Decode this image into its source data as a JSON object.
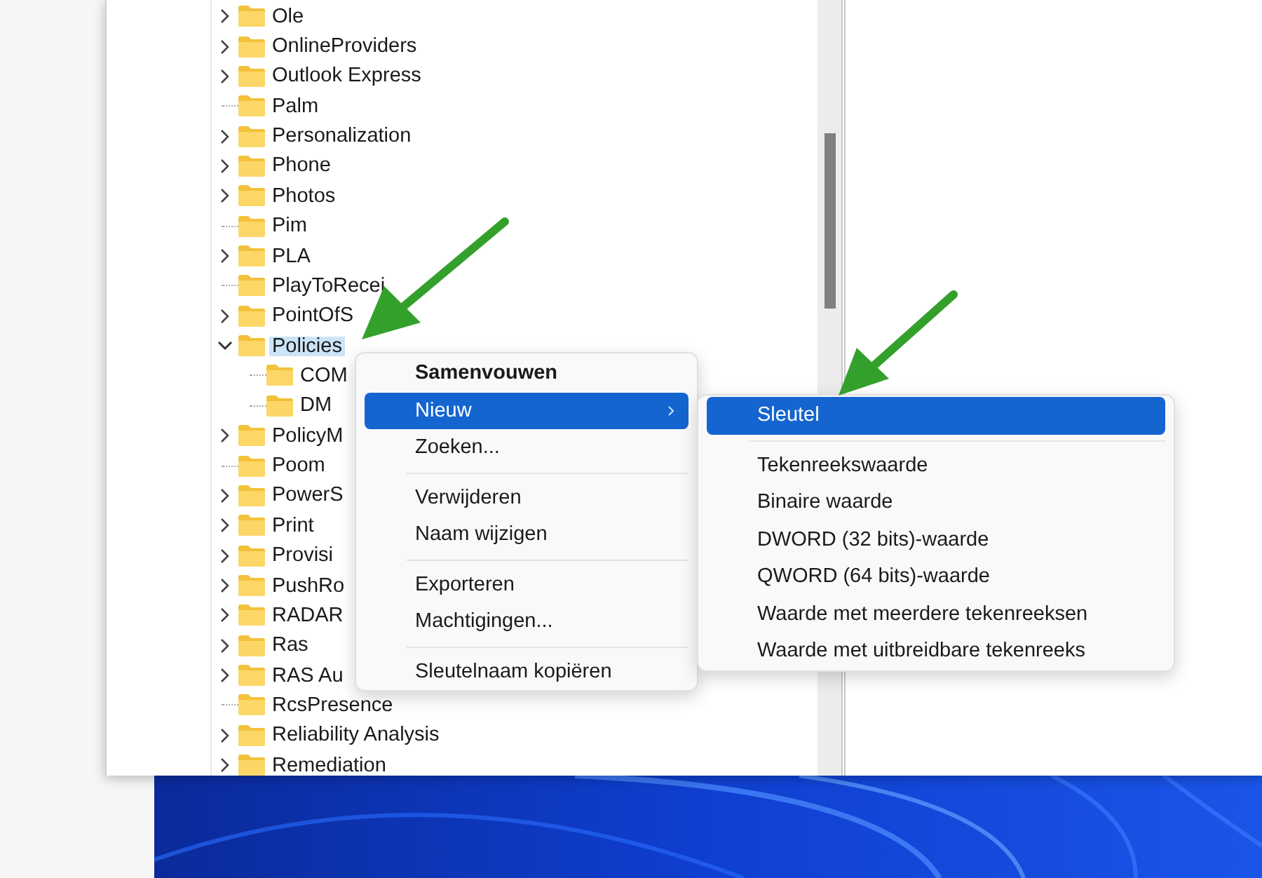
{
  "tree": [
    {
      "label": "Ole",
      "expandable": true,
      "expanded": false,
      "selected": false
    },
    {
      "label": "OnlineProviders",
      "expandable": true,
      "expanded": false,
      "selected": false
    },
    {
      "label": "Outlook Express",
      "expandable": true,
      "expanded": false,
      "selected": false
    },
    {
      "label": "Palm",
      "expandable": false,
      "selected": false
    },
    {
      "label": "Personalization",
      "expandable": true,
      "expanded": false,
      "selected": false
    },
    {
      "label": "Phone",
      "expandable": true,
      "expanded": false,
      "selected": false
    },
    {
      "label": "Photos",
      "expandable": true,
      "expanded": false,
      "selected": false
    },
    {
      "label": "Pim",
      "expandable": false,
      "selected": false
    },
    {
      "label": "PLA",
      "expandable": true,
      "expanded": false,
      "selected": false
    },
    {
      "label": "PlayToRecei",
      "expandable": false,
      "selected": false
    },
    {
      "label": "PointOfS",
      "expandable": true,
      "expanded": false,
      "selected": false
    },
    {
      "label": "Policies",
      "expandable": true,
      "expanded": true,
      "selected": true,
      "children": [
        {
          "label": "COM",
          "expandable": false,
          "selected": false
        },
        {
          "label": "DM",
          "expandable": false,
          "selected": false
        }
      ]
    },
    {
      "label": "PolicyM",
      "expandable": true,
      "expanded": false,
      "selected": false
    },
    {
      "label": "Poom",
      "expandable": false,
      "selected": false
    },
    {
      "label": "PowerS",
      "expandable": true,
      "expanded": false,
      "selected": false
    },
    {
      "label": "Print",
      "expandable": true,
      "expanded": false,
      "selected": false
    },
    {
      "label": "Provisi",
      "expandable": true,
      "expanded": false,
      "selected": false
    },
    {
      "label": "PushRo",
      "expandable": true,
      "expanded": false,
      "selected": false
    },
    {
      "label": "RADAR",
      "expandable": true,
      "expanded": false,
      "selected": false
    },
    {
      "label": "Ras",
      "expandable": true,
      "expanded": false,
      "selected": false
    },
    {
      "label": "RAS Au",
      "expandable": true,
      "expanded": false,
      "selected": false
    },
    {
      "label": "RcsPresence",
      "expandable": false,
      "selected": false
    },
    {
      "label": "Reliability Analysis",
      "expandable": true,
      "expanded": false,
      "selected": false
    },
    {
      "label": "Remediation",
      "expandable": true,
      "expanded": false,
      "selected": false
    }
  ],
  "context_menu": {
    "items": [
      {
        "kind": "item",
        "label": "Samenvouwen",
        "bold": true,
        "selected": false,
        "submenu": false
      },
      {
        "kind": "item",
        "label": "Nieuw",
        "bold": false,
        "selected": true,
        "submenu": true
      },
      {
        "kind": "item",
        "label": "Zoeken...",
        "bold": false,
        "selected": false,
        "submenu": false
      },
      {
        "kind": "separator"
      },
      {
        "kind": "item",
        "label": "Verwijderen",
        "bold": false,
        "selected": false,
        "submenu": false
      },
      {
        "kind": "item",
        "label": "Naam wijzigen",
        "bold": false,
        "selected": false,
        "submenu": false
      },
      {
        "kind": "separator"
      },
      {
        "kind": "item",
        "label": "Exporteren",
        "bold": false,
        "selected": false,
        "submenu": false
      },
      {
        "kind": "item",
        "label": "Machtigingen...",
        "bold": false,
        "selected": false,
        "submenu": false
      },
      {
        "kind": "separator"
      },
      {
        "kind": "item",
        "label": "Sleutelnaam kopiëren",
        "bold": false,
        "selected": false,
        "submenu": false
      }
    ]
  },
  "submenu": {
    "items": [
      {
        "kind": "item",
        "label": "Sleutel",
        "bold": false,
        "selected": true,
        "submenu": false
      },
      {
        "kind": "separator"
      },
      {
        "kind": "item",
        "label": "Tekenreekswaarde",
        "bold": false,
        "selected": false,
        "submenu": false
      },
      {
        "kind": "item",
        "label": "Binaire waarde",
        "bold": false,
        "selected": false,
        "submenu": false
      },
      {
        "kind": "item",
        "label": "DWORD (32 bits)-waarde",
        "bold": false,
        "selected": false,
        "submenu": false
      },
      {
        "kind": "item",
        "label": "QWORD (64 bits)-waarde",
        "bold": false,
        "selected": false,
        "submenu": false
      },
      {
        "kind": "item",
        "label": "Waarde met meerdere tekenreeksen",
        "bold": false,
        "selected": false,
        "submenu": false
      },
      {
        "kind": "item",
        "label": "Waarde met uitbreidbare tekenreeks",
        "bold": false,
        "selected": false,
        "submenu": false
      }
    ]
  }
}
